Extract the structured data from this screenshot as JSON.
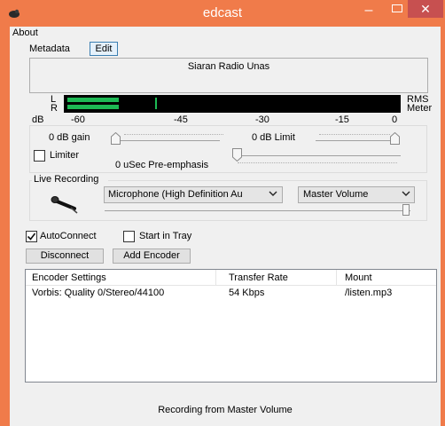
{
  "window": {
    "title": "edcast"
  },
  "menu": {
    "about": "About"
  },
  "tabs": {
    "metadata": "Metadata",
    "edit": "Edit"
  },
  "metadata_text": "Siaran Radio Unas",
  "meter": {
    "l_label": "L",
    "r_label": "R",
    "rms_label": "RMS",
    "meter_label": "Meter",
    "db_label": "dB",
    "scale": [
      "-60",
      "-45",
      "-30",
      "-15",
      "0"
    ]
  },
  "controls": {
    "gain_label": "0 dB gain",
    "limit_label": "0 dB Limit",
    "limiter_label": "Limiter",
    "preemphasis_label": "0  uSec Pre-emphasis"
  },
  "live_recording": {
    "label": "Live Recording",
    "device": "Microphone (High Definition Au",
    "volume": "Master Volume"
  },
  "options": {
    "autoconnect": "AutoConnect",
    "start_in_tray": "Start in Tray",
    "autoconnect_checked": true,
    "start_in_tray_checked": false
  },
  "buttons": {
    "disconnect": "Disconnect",
    "add_encoder": "Add Encoder"
  },
  "encoders": {
    "columns": [
      "Encoder Settings",
      "Transfer Rate",
      "Mount"
    ],
    "rows": [
      [
        "Vorbis: Quality 0/Stereo/44100",
        "54 Kbps",
        "/listen.mp3"
      ]
    ]
  },
  "status": "Recording from Master Volume",
  "colors": {
    "accent": "#f07b4a",
    "meter_green": "#1db954"
  }
}
